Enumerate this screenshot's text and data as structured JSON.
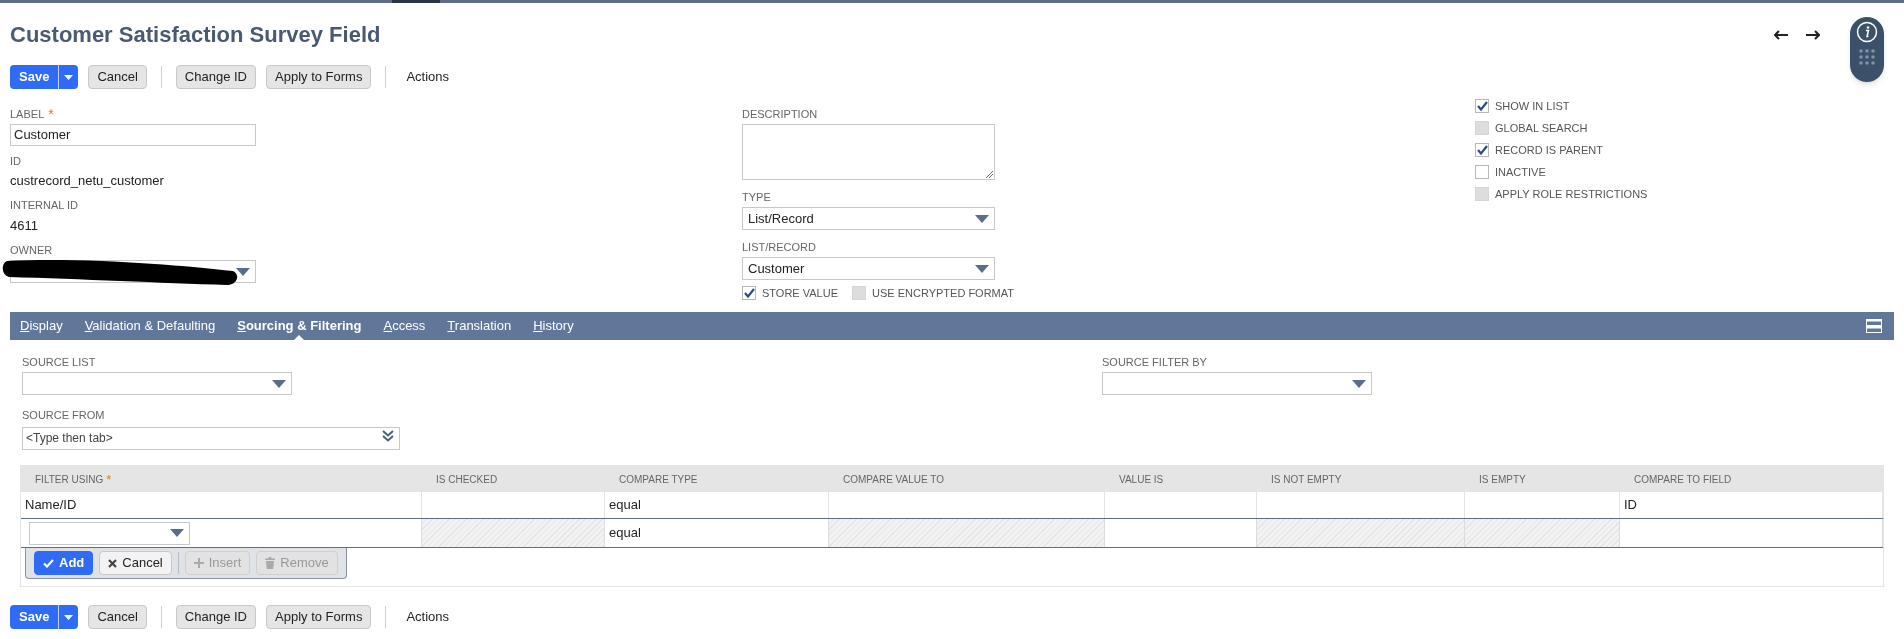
{
  "page": {
    "title": "Customer Satisfaction Survey Field"
  },
  "toolbar": [
    {
      "label": "Save",
      "kind": "primary"
    },
    {
      "label": "Cancel",
      "kind": "button"
    },
    {
      "label": "Change ID",
      "kind": "button"
    },
    {
      "label": "Apply to Forms",
      "kind": "button"
    },
    {
      "label": "Actions",
      "kind": "menu"
    }
  ],
  "main_fields": [
    {
      "label": "LABEL",
      "required_mark": "*",
      "kind": "input",
      "value": "Customer"
    },
    {
      "label": "ID",
      "kind": "text",
      "value": "custrecord_netu_customer"
    },
    {
      "label": "INTERNAL ID",
      "kind": "text",
      "value": "4611"
    },
    {
      "label": "OWNER",
      "kind": "select",
      "redacted": true
    }
  ],
  "middle_fields": [
    {
      "label": "DESCRIPTION",
      "kind": "textarea"
    },
    {
      "label": "TYPE",
      "kind": "select",
      "value": "List/Record"
    },
    {
      "label": "LIST/RECORD",
      "kind": "select",
      "value": "Customer"
    }
  ],
  "middle_checkboxes": [
    {
      "label": "STORE VALUE",
      "checked": true,
      "disabled": false
    },
    {
      "label": "USE ENCRYPTED FORMAT",
      "checked": false,
      "disabled": true
    }
  ],
  "right_checkboxes": [
    {
      "label": "SHOW IN LIST",
      "checked": true,
      "disabled": false
    },
    {
      "label": "GLOBAL SEARCH",
      "checked": false,
      "disabled": true
    },
    {
      "label": "RECORD IS PARENT",
      "checked": true,
      "disabled": false
    },
    {
      "label": "INACTIVE",
      "checked": false,
      "disabled": false
    },
    {
      "label": "APPLY ROLE RESTRICTIONS",
      "checked": false,
      "disabled": true
    }
  ],
  "tabs": [
    {
      "label": "Display",
      "selected": false
    },
    {
      "label": "Validation & Defaulting",
      "selected": false
    },
    {
      "label": "Sourcing & Filtering",
      "selected": true
    },
    {
      "label": "Access",
      "selected": false
    },
    {
      "label": "Translation",
      "selected": false
    },
    {
      "label": "History",
      "selected": false
    }
  ],
  "sourcing": {
    "source_list": {
      "label": "SOURCE LIST"
    },
    "source_from": {
      "label": "SOURCE FROM",
      "placeholder": "<Type then tab>"
    },
    "source_filter_by": {
      "label": "SOURCE FILTER BY"
    }
  },
  "table": {
    "columns": [
      {
        "label": "FILTER USING",
        "required_mark": "*",
        "editable": true
      },
      {
        "label": "IS CHECKED",
        "editable": false
      },
      {
        "label": "COMPARE TYPE",
        "editable": true
      },
      {
        "label": "COMPARE VALUE TO",
        "editable": false
      },
      {
        "label": "VALUE IS",
        "editable": true
      },
      {
        "label": "IS NOT EMPTY",
        "editable": false
      },
      {
        "label": "IS EMPTY",
        "editable": false
      },
      {
        "label": "COMPARE TO FIELD",
        "editable": true
      }
    ],
    "rows": [
      {
        "editing": false,
        "cells": [
          "Name/ID",
          null,
          "equal",
          null,
          null,
          null,
          null,
          "ID"
        ]
      },
      {
        "editing": true,
        "cells": [
          null,
          null,
          "equal",
          null,
          null,
          null,
          null,
          null
        ]
      }
    ],
    "row_buttons": [
      {
        "label": "Add",
        "kind": "primary",
        "disabled": false
      },
      {
        "label": "Cancel",
        "kind": "cancel",
        "disabled": false
      },
      {
        "label": "Insert",
        "kind": "insert",
        "disabled": true
      },
      {
        "label": "Remove",
        "kind": "remove",
        "disabled": true
      }
    ]
  },
  "bottom_toolbar": [
    {
      "label": "Save",
      "kind": "primary"
    },
    {
      "label": "Cancel",
      "kind": "button"
    },
    {
      "label": "Change ID",
      "kind": "button"
    },
    {
      "label": "Apply to Forms",
      "kind": "button"
    },
    {
      "label": "Actions",
      "kind": "menu"
    }
  ]
}
